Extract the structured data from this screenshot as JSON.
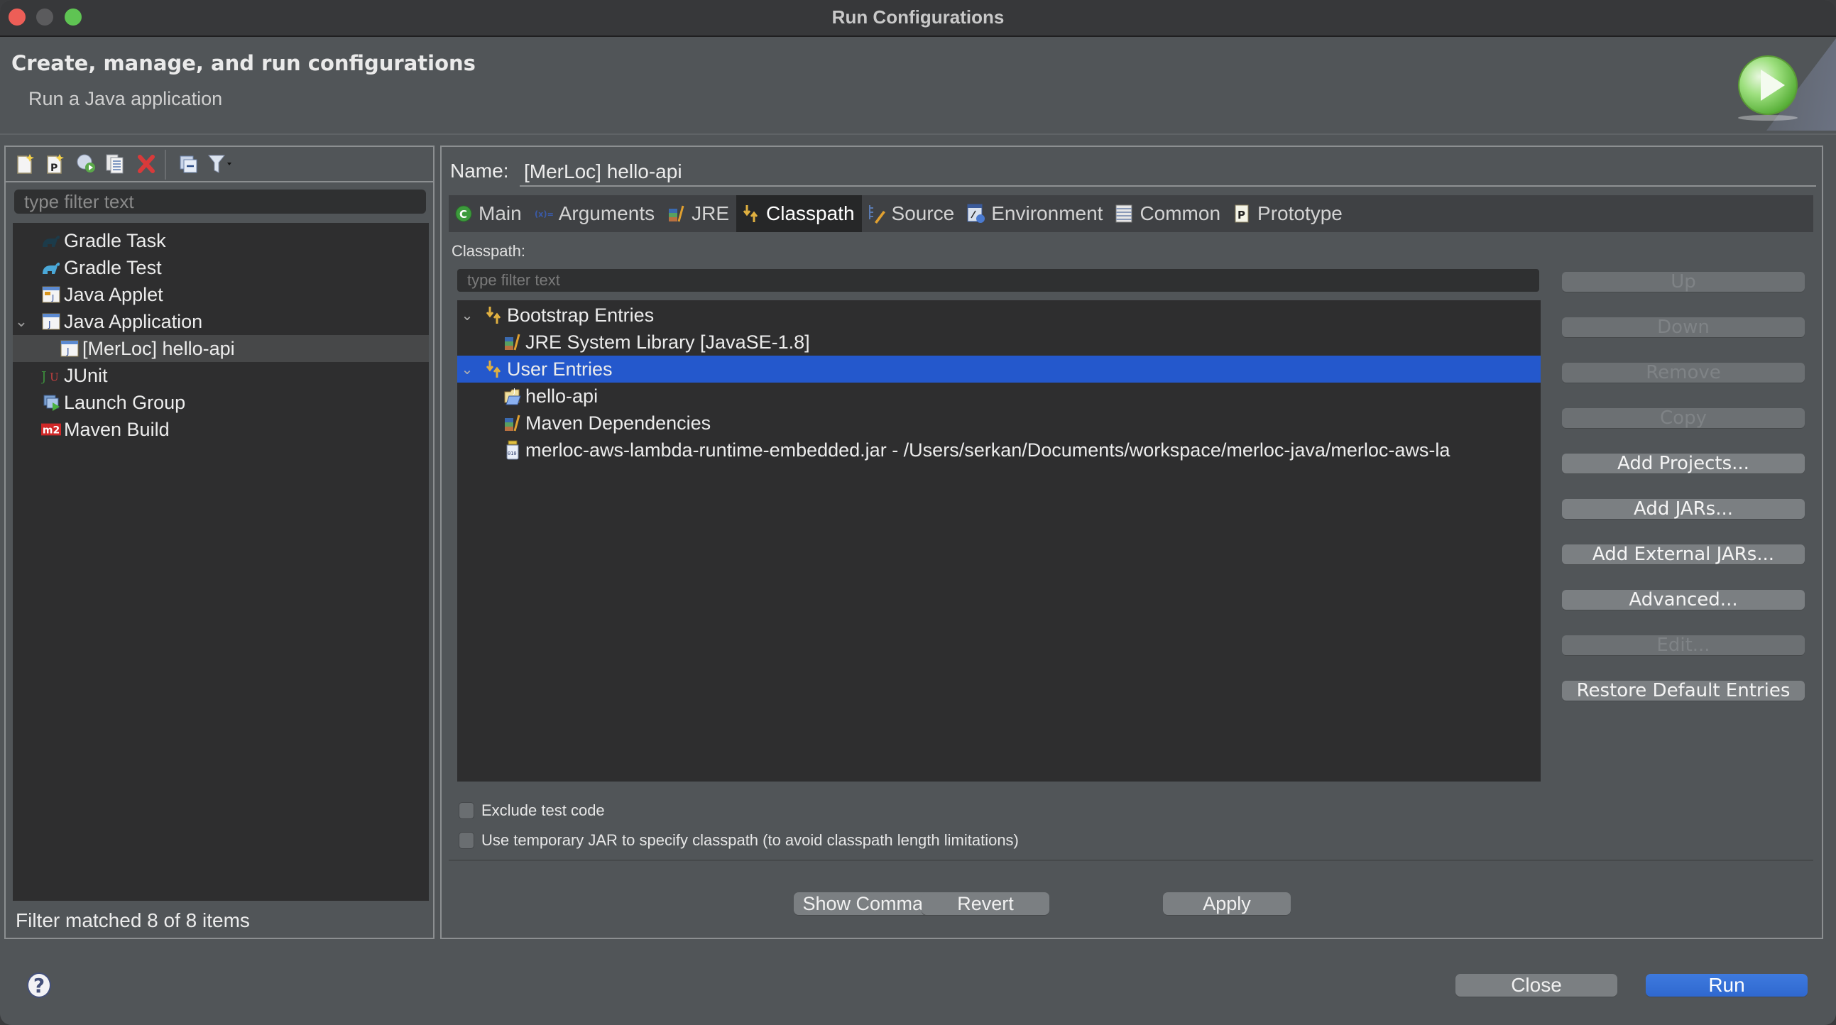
{
  "window": {
    "title": "Run Configurations"
  },
  "header": {
    "title": "Create, manage, and run configurations",
    "subtitle": "Run a Java application"
  },
  "left_panel": {
    "toolbar": [
      {
        "name": "new-configuration-icon"
      },
      {
        "name": "new-prototype-icon"
      },
      {
        "name": "export-configuration-icon"
      },
      {
        "name": "duplicate-configuration-icon"
      },
      {
        "name": "delete-configuration-icon"
      },
      {
        "name": "collapse-all-icon"
      },
      {
        "name": "filter-icon"
      }
    ],
    "filter_placeholder": "type filter text",
    "tree": [
      {
        "label": "Gradle Task",
        "icon": "gradle-task-icon",
        "level": 0,
        "expanded": null,
        "selected": false
      },
      {
        "label": "Gradle Test",
        "icon": "gradle-test-icon",
        "level": 0,
        "expanded": null,
        "selected": false
      },
      {
        "label": "Java Applet",
        "icon": "java-applet-icon",
        "level": 0,
        "expanded": null,
        "selected": false
      },
      {
        "label": "Java Application",
        "icon": "java-application-icon",
        "level": 0,
        "expanded": true,
        "selected": false
      },
      {
        "label": "[MerLoc] hello-api",
        "icon": "java-application-icon",
        "level": 1,
        "expanded": null,
        "selected": true
      },
      {
        "label": "JUnit",
        "icon": "junit-icon",
        "level": 0,
        "expanded": null,
        "selected": false
      },
      {
        "label": "Launch Group",
        "icon": "launch-group-icon",
        "level": 0,
        "expanded": null,
        "selected": false
      },
      {
        "label": "Maven Build",
        "icon": "maven-build-icon",
        "level": 0,
        "expanded": null,
        "selected": false
      }
    ],
    "status": "Filter matched 8 of 8 items"
  },
  "config": {
    "name_label": "Name:",
    "name_value": "[MerLoc] hello-api",
    "tabs": [
      {
        "label": "Main",
        "icon": "main-class-icon",
        "active": false
      },
      {
        "label": "Arguments",
        "icon": "arguments-icon",
        "active": false
      },
      {
        "label": "JRE",
        "icon": "jre-library-icon",
        "active": false
      },
      {
        "label": "Classpath",
        "icon": "classpath-icon",
        "active": true
      },
      {
        "label": "Source",
        "icon": "source-icon",
        "active": false
      },
      {
        "label": "Environment",
        "icon": "environment-icon",
        "active": false
      },
      {
        "label": "Common",
        "icon": "common-icon",
        "active": false
      },
      {
        "label": "Prototype",
        "icon": "prototype-icon",
        "active": false
      }
    ],
    "classpath": {
      "label": "Classpath:",
      "filter_placeholder": "type filter text",
      "entries": [
        {
          "label": "Bootstrap Entries",
          "icon": "classpath-entries-icon",
          "level": 0,
          "expanded": true,
          "selected": false
        },
        {
          "label": "JRE System Library [JavaSE-1.8]",
          "icon": "library-icon",
          "level": 1,
          "expanded": null,
          "selected": false
        },
        {
          "label": "User Entries",
          "icon": "classpath-entries-icon",
          "level": 0,
          "expanded": true,
          "selected": true
        },
        {
          "label": "hello-api",
          "icon": "java-project-icon",
          "level": 1,
          "expanded": null,
          "selected": false
        },
        {
          "label": "Maven Dependencies",
          "icon": "library-icon",
          "level": 1,
          "expanded": null,
          "selected": false
        },
        {
          "label": "merloc-aws-lambda-runtime-embedded.jar - /Users/serkan/Documents/workspace/merloc-java/merloc-aws-la",
          "icon": "jar-file-icon",
          "level": 1,
          "expanded": null,
          "selected": false
        }
      ],
      "buttons": [
        {
          "label": "Up",
          "enabled": false
        },
        {
          "label": "Down",
          "enabled": false
        },
        {
          "label": "Remove",
          "enabled": false
        },
        {
          "label": "Copy",
          "enabled": false
        },
        {
          "label": "Add Projects...",
          "enabled": true
        },
        {
          "label": "Add JARs...",
          "enabled": true
        },
        {
          "label": "Add External JARs...",
          "enabled": true
        },
        {
          "label": "Advanced...",
          "enabled": true
        },
        {
          "label": "Edit...",
          "enabled": false
        },
        {
          "label": "Restore Default Entries",
          "enabled": true
        }
      ],
      "checkboxes": [
        {
          "label": "Exclude test code",
          "checked": false
        },
        {
          "label": "Use temporary JAR to specify classpath (to avoid classpath length limitations)",
          "checked": false
        }
      ]
    },
    "actions": {
      "show_command_line": "Show Command Lir",
      "revert": "Revert",
      "apply": "Apply"
    }
  },
  "footer": {
    "close": "Close",
    "run": "Run"
  },
  "colors": {
    "selection": "#2458cc",
    "run_button": "#3472d8",
    "background": "#515558",
    "tree_background": "#2e2e2f"
  }
}
